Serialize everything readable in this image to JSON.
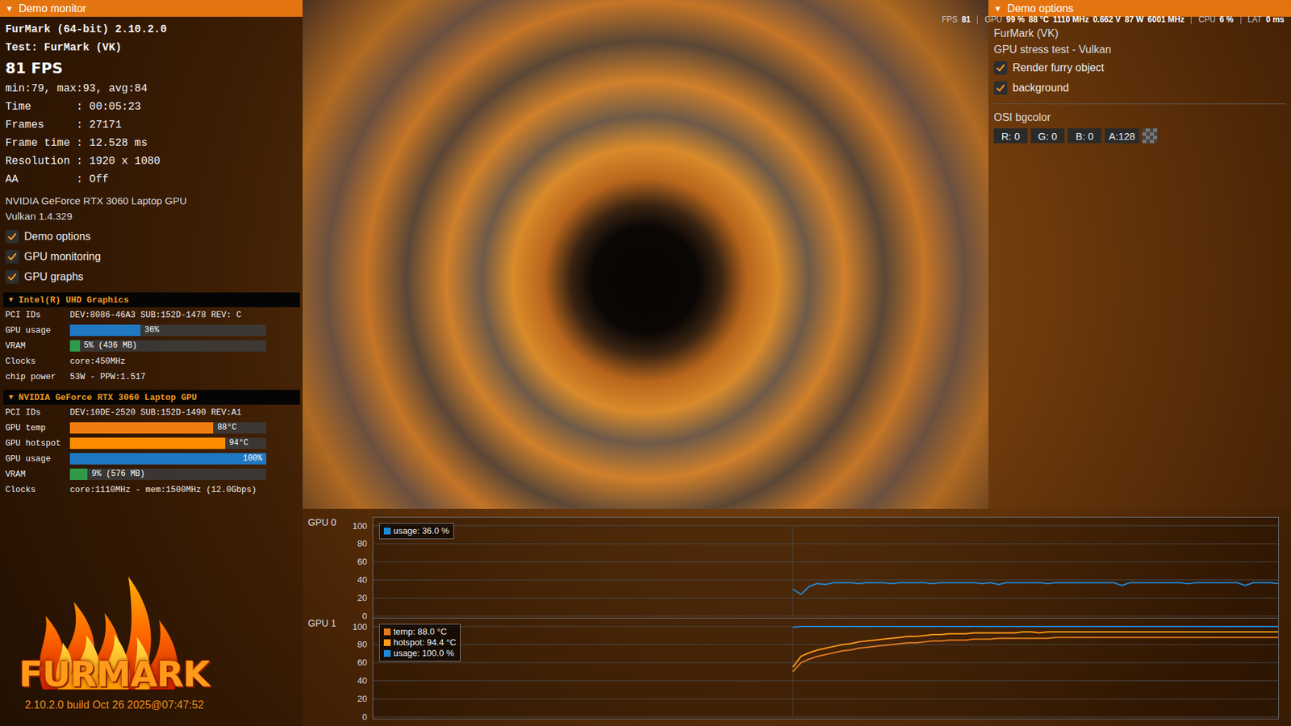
{
  "monitor": {
    "title": "Demo monitor",
    "toggle_icon": "▼",
    "app_name": "FurMark (64-bit) 2.10.2.0",
    "test": "Test: FurMark (VK)",
    "fps": "81 FPS",
    "fps_stats": "min:79, max:93, avg:84",
    "separator": ":",
    "info": [
      {
        "label": "Time",
        "value": "00:05:23"
      },
      {
        "label": "Frames",
        "value": "27171"
      },
      {
        "label": "Frame time",
        "value": "12.528 ms"
      },
      {
        "label": "Resolution",
        "value": "1920 x 1080"
      },
      {
        "label": "AA",
        "value": "Off"
      }
    ],
    "renderer": "NVIDIA GeForce RTX 3060 Laptop GPU",
    "api": "Vulkan 1.4.329",
    "options": [
      {
        "label": "Demo options",
        "checked": true
      },
      {
        "label": "GPU monitoring",
        "checked": true
      },
      {
        "label": "GPU graphs",
        "checked": true
      }
    ],
    "gpus": [
      {
        "name": "Intel(R) UHD Graphics",
        "expanded": true,
        "rows": [
          {
            "kind": "text",
            "label": "PCI IDs",
            "value": "DEV:8086-46A3 SUB:152D-1478 REV: C"
          },
          {
            "kind": "bar",
            "label": "GPU usage",
            "reading": "36%",
            "level": 0.36,
            "color": "#1f78c1"
          },
          {
            "kind": "bar",
            "label": "VRAM",
            "reading": "5% (436 MB)",
            "level": 0.05,
            "color": "#2e9a4a"
          },
          {
            "kind": "text",
            "label": "Clocks",
            "value": "core:450MHz"
          },
          {
            "kind": "text",
            "label": "chip power",
            "value": "53W - PPW:1.517"
          }
        ]
      },
      {
        "name": "NVIDIA GeForce RTX 3060 Laptop GPU",
        "expanded": true,
        "rows": [
          {
            "kind": "text",
            "label": "PCI IDs",
            "value": "DEV:10DE-2520 SUB:152D-1490 REV:A1"
          },
          {
            "kind": "bar",
            "label": "GPU temp",
            "reading": "88°C",
            "level": 0.73,
            "color": "#f07d10"
          },
          {
            "kind": "bar",
            "label": "GPU hotspot",
            "reading": "94°C",
            "level": 0.79,
            "color": "#ff8c00"
          },
          {
            "kind": "bar",
            "label": "GPU usage",
            "reading": "100%",
            "level": 1.0,
            "color": "#1f78c1"
          },
          {
            "kind": "bar",
            "label": "VRAM",
            "reading": "9% (576 MB)",
            "level": 0.09,
            "color": "#2e9a4a"
          },
          {
            "kind": "text",
            "label": "Clocks",
            "value": "core:1110MHz - mem:1500MHz (12.0Gbps)"
          }
        ]
      }
    ]
  },
  "logo": {
    "text": "FURMARK",
    "build": "2.10.2.0 build Oct 26 2025@07:47:52"
  },
  "status_strip": [
    {
      "label": "FPS",
      "values": [
        "81"
      ]
    },
    {
      "label": "GPU",
      "values": [
        "99 %",
        "88 °C",
        "1110 MHz",
        "0.662 V",
        "87 W",
        "6001 MHz"
      ]
    },
    {
      "label": "CPU",
      "values": [
        "6 %"
      ]
    },
    {
      "label": "LAT",
      "values": [
        "0 ms"
      ]
    }
  ],
  "options_panel": {
    "title": "Demo options",
    "toggle_icon": "▼",
    "demo": "FurMark (VK)",
    "description": "GPU stress test - Vulkan",
    "checks": [
      {
        "label": "Render furry object",
        "checked": true
      },
      {
        "label": "background",
        "checked": true
      }
    ],
    "color_label": "OSI bgcolor",
    "fields": [
      {
        "text": "R: 0"
      },
      {
        "text": "G: 0"
      },
      {
        "text": "B: 0"
      },
      {
        "text": "A:128"
      }
    ]
  },
  "graphs": [
    {
      "label": "GPU 0",
      "ticks": [
        "100",
        "80",
        "60",
        "40",
        "20",
        "0"
      ],
      "series": [
        {
          "name": "usage: 36.0 %",
          "color": "#1e88d8",
          "values": [
            30,
            24,
            33,
            36,
            35,
            37,
            37,
            37,
            36,
            37,
            37,
            37,
            36,
            37,
            37,
            37,
            37,
            36,
            37,
            37,
            37,
            37,
            37,
            36,
            37,
            35,
            37,
            37,
            37,
            37,
            37,
            36,
            37,
            37,
            37,
            37,
            37,
            37,
            37,
            37,
            34,
            37,
            37,
            37,
            37,
            37,
            37,
            37,
            36,
            37,
            37,
            37,
            37,
            37,
            37,
            34,
            37,
            37,
            37,
            36
          ]
        }
      ]
    },
    {
      "label": "GPU 1",
      "ticks": [
        "100",
        "80",
        "60",
        "40",
        "20",
        "0"
      ],
      "series": [
        {
          "name": "temp: 88.0 °C",
          "color": "#e07b20",
          "values": [
            50,
            60,
            64,
            67,
            69,
            71,
            73,
            74,
            76,
            77,
            78,
            79,
            80,
            81,
            82,
            82,
            83,
            84,
            84,
            85,
            85,
            85,
            86,
            86,
            86,
            87,
            87,
            87,
            87,
            87,
            87,
            87,
            88,
            88,
            88,
            88,
            88,
            88,
            88,
            88,
            88,
            88,
            88,
            88,
            88,
            88,
            88,
            88,
            88,
            88,
            88,
            88,
            88,
            88,
            88,
            88,
            88,
            88,
            88,
            88
          ]
        },
        {
          "name": "hotspot: 94.4 °C",
          "color": "#ff9a1a",
          "values": [
            55,
            67,
            71,
            74,
            76,
            78,
            80,
            81,
            83,
            84,
            85,
            86,
            87,
            88,
            89,
            89,
            90,
            91,
            91,
            92,
            92,
            92,
            93,
            93,
            93,
            93,
            93,
            93,
            94,
            94,
            93,
            94,
            94,
            94,
            94,
            94,
            94,
            94,
            94,
            94,
            94,
            94,
            94,
            94,
            94,
            94,
            94,
            94,
            94,
            94,
            94,
            94,
            94,
            94,
            94,
            94,
            94,
            94,
            94,
            94
          ]
        },
        {
          "name": "usage: 100.0 %",
          "color": "#1e88d8",
          "values": [
            99,
            100,
            100,
            100,
            100,
            100,
            100,
            100,
            100,
            100,
            100,
            100,
            100,
            100,
            100,
            100,
            100,
            100,
            100,
            100,
            100,
            100,
            100,
            100,
            100,
            100,
            100,
            100,
            100,
            100,
            100,
            100,
            100,
            100,
            100,
            100,
            100,
            100,
            100,
            100,
            100,
            100,
            100,
            100,
            100,
            100,
            100,
            100,
            100,
            100,
            100,
            100,
            100,
            100,
            100,
            100,
            100,
            100,
            100,
            100
          ]
        }
      ]
    }
  ]
}
